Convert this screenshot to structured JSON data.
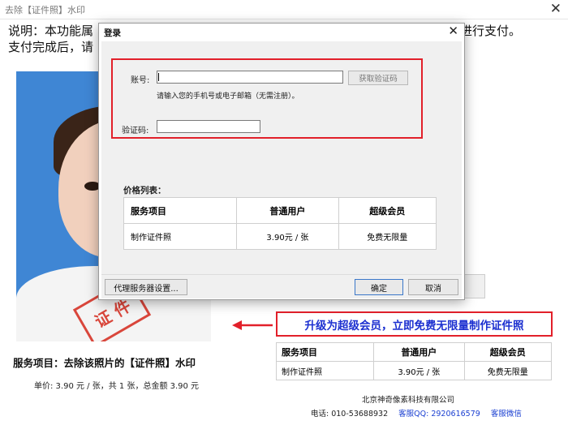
{
  "window": {
    "title": "去除【证件照】水印"
  },
  "description": {
    "line1_left": "说明：本功能属",
    "line1_right": "码，进行支付。",
    "line2_left": "支付完成后，请"
  },
  "photo": {
    "stamp_text": "证 件"
  },
  "service": {
    "title": "服务项目：去除该照片的【证件照】水印",
    "unit_price": "单价: 3.90 元 / 张，共 1 张，总金额 3.90 元"
  },
  "upgrade": {
    "text": "升级为超级会员，立即免费无限量制作证件照"
  },
  "background_table": {
    "headers": [
      "服务项目",
      "普通用户",
      "超级会员"
    ],
    "row": [
      "制作证件照",
      "3.90元 / 张",
      "免费无限量"
    ]
  },
  "footer_info": {
    "company": "北京神奇像素科技有限公司",
    "phone": "电话: 010-53688932",
    "qq_label": "客服QQ: 2920616579",
    "wechat_label": "客服微信"
  },
  "dialog": {
    "title": "登录",
    "account_label": "账号:",
    "account_value": "",
    "get_code_label": "获取验证码",
    "hint": "请输入您的手机号或电子邮箱（无需注册）。",
    "code_label": "验证码:",
    "code_value": "",
    "price_list_label": "价格列表：",
    "price_table": {
      "headers": [
        "服务项目",
        "普通用户",
        "超级会员"
      ],
      "row": [
        "制作证件照",
        "3.90元 / 张",
        "免费无限量"
      ]
    },
    "proxy_button": "代理服务器设置...",
    "ok_button": "确定",
    "cancel_button": "取消"
  },
  "colors": {
    "highlight_border": "#e2202a",
    "link_blue": "#1a3fd1",
    "photo_bg": "#3f86d4"
  },
  "icons": {
    "close": "close-icon"
  }
}
